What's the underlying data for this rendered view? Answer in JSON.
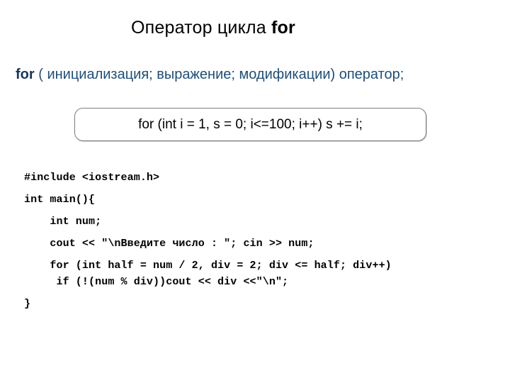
{
  "slide": {
    "background_color": "#ffffff",
    "title": {
      "prefix": "Оператор цикла ",
      "keyword": "for"
    },
    "syntax_line": {
      "keyword": "for",
      "rest": " ( инициализация; выражение; модификации) оператор;",
      "color": "#1f4e79",
      "keyword_color": "#17365d"
    },
    "example_box": {
      "code": "for (int i = 1, s = 0; i<=100; i++) s += i;",
      "border_color": "#7d7d7d",
      "text_color": "#000000"
    },
    "code_block": {
      "language": "cpp",
      "text_color": "#000000",
      "lines": [
        "#include <iostream.h>",
        "int main(){",
        "    int num;",
        "    cout << \"\\nВведите число : \"; cin >> num;",
        "    for (int half = num / 2, div = 2; div <= half; div++)",
        "     if (!(num % div))cout << div <<\"\\n\";",
        "}"
      ]
    }
  }
}
